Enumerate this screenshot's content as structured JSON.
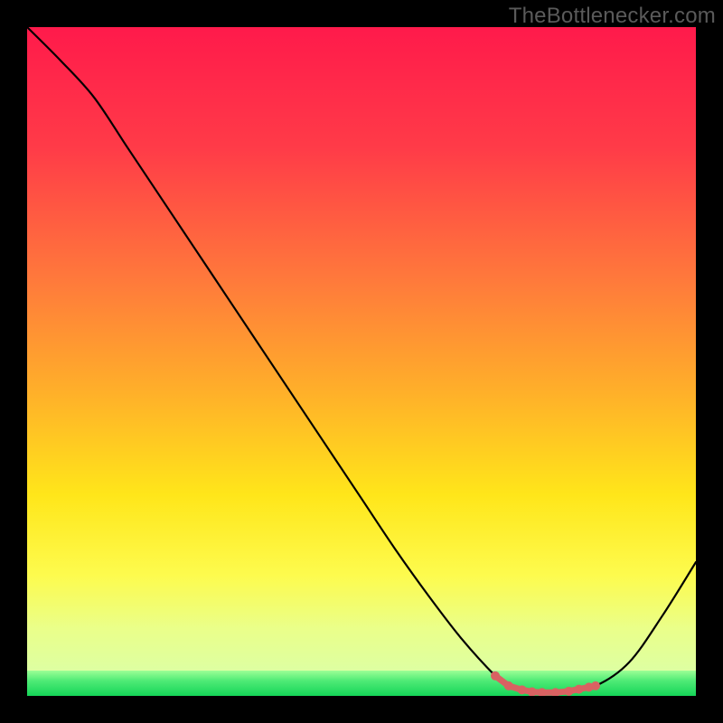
{
  "watermark": "TheBottlenecker.com",
  "chart_data": {
    "type": "line",
    "title": "",
    "xlabel": "",
    "ylabel": "",
    "xlim": [
      0,
      100
    ],
    "ylim": [
      0,
      100
    ],
    "x": [
      0,
      5,
      10,
      15,
      20,
      25,
      30,
      35,
      40,
      45,
      50,
      55,
      60,
      65,
      70,
      72,
      75,
      80,
      85,
      90,
      95,
      100
    ],
    "values": [
      100,
      95,
      89.5,
      82,
      74.5,
      67,
      59.5,
      52,
      44.5,
      37,
      29.5,
      22,
      15,
      8.5,
      3,
      1.5,
      0.5,
      0.5,
      1.5,
      5,
      12,
      20
    ],
    "series": [
      {
        "name": "curve",
        "color": "#000000",
        "values": [
          100,
          95,
          89.5,
          82,
          74.5,
          67,
          59.5,
          52,
          44.5,
          37,
          29.5,
          22,
          15,
          8.5,
          3,
          1.5,
          0.5,
          0.5,
          1.5,
          5,
          12,
          20
        ]
      }
    ],
    "markers": {
      "name": "bottom-markers",
      "color": "#d96262",
      "radius": 5,
      "x": [
        70,
        72,
        74,
        75.5,
        77,
        79,
        81,
        82.5,
        84,
        85
      ],
      "y": [
        3,
        1.5,
        0.9,
        0.6,
        0.5,
        0.5,
        0.7,
        1,
        1.3,
        1.5
      ]
    },
    "background_gradient": {
      "stops": [
        {
          "pos": 0,
          "color": "#ff1a4b"
        },
        {
          "pos": 0.18,
          "color": "#ff3b48"
        },
        {
          "pos": 0.38,
          "color": "#ff7a3b"
        },
        {
          "pos": 0.55,
          "color": "#ffb129"
        },
        {
          "pos": 0.7,
          "color": "#ffe61a"
        },
        {
          "pos": 0.82,
          "color": "#fdfb4e"
        },
        {
          "pos": 0.9,
          "color": "#eaff8a"
        },
        {
          "pos": 1.0,
          "color": "#d6ffb0"
        }
      ]
    },
    "green_strip": {
      "height_frac": 0.038,
      "stops": [
        {
          "pos": 0,
          "color": "#9cff95"
        },
        {
          "pos": 0.4,
          "color": "#4feb76"
        },
        {
          "pos": 1,
          "color": "#15d558"
        }
      ]
    }
  }
}
